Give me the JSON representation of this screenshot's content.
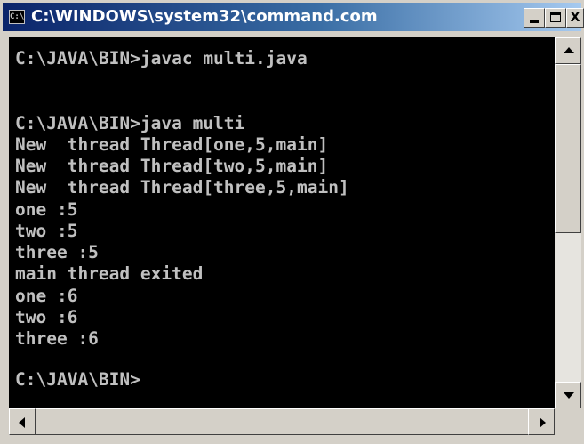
{
  "window": {
    "title": "C:\\WINDOWS\\system32\\command.com",
    "icon_label": "C:\\"
  },
  "controls": {
    "minimize": "minimize",
    "maximize": "maximize",
    "close": "X"
  },
  "console": {
    "lines": [
      "C:\\JAVA\\BIN>javac multi.java",
      "C:\\JAVA\\BIN>java multi",
      "New  thread Thread[one,5,main]",
      "New  thread Thread[two,5,main]",
      "New  thread Thread[three,5,main]",
      "one :5",
      "two :5",
      "three :5",
      "main thread exited",
      "one :6",
      "two :6",
      "three :6",
      "C:\\JAVA\\BIN>"
    ]
  },
  "colors": {
    "console_bg": "#000000",
    "console_text": "#c0c0c0",
    "title_bar": "#0a246a"
  }
}
